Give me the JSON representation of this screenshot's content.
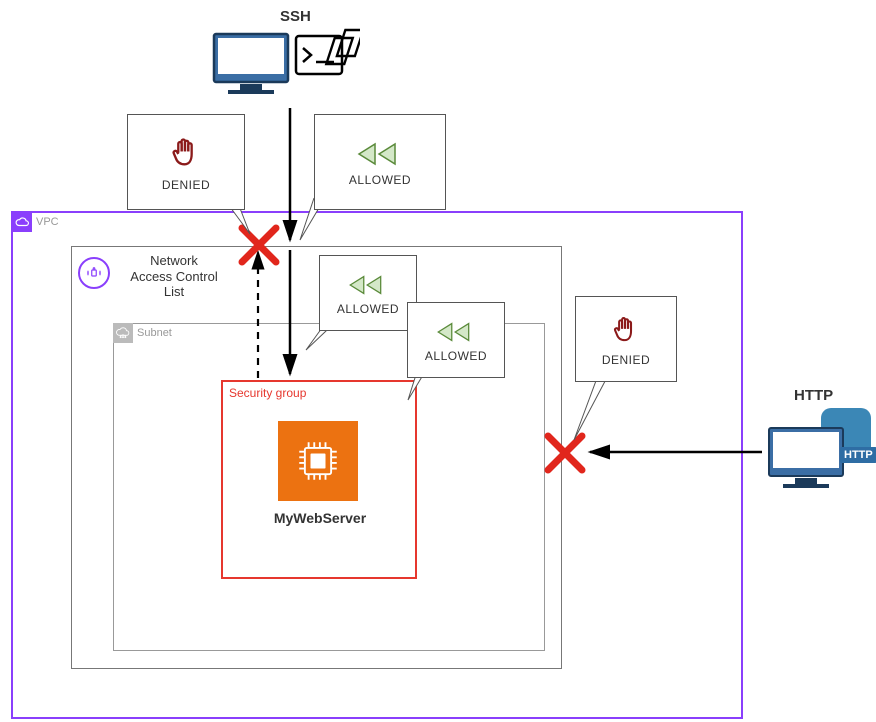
{
  "protocols": {
    "ssh": "SSH",
    "http": "HTTP"
  },
  "vpc": {
    "label": "VPC"
  },
  "nacl": {
    "label": "Network\nAccess Control\nList"
  },
  "subnet": {
    "label": "Subnet"
  },
  "sg": {
    "label": "Security group"
  },
  "server": {
    "label": "MyWebServer"
  },
  "status": {
    "denied": "DENIED",
    "allowed": "ALLOWED"
  },
  "http_badge": "HTTP"
}
